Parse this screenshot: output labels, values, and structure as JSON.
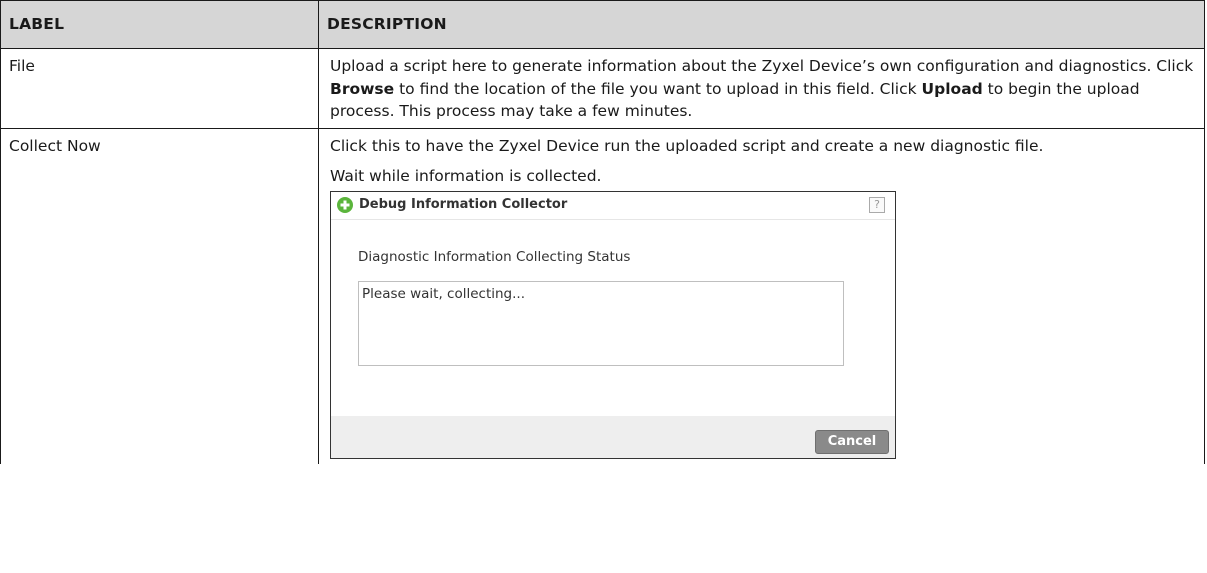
{
  "table": {
    "headers": {
      "label": "LABEL",
      "description": "DESCRIPTION"
    },
    "rows": [
      {
        "label": "File",
        "desc_parts": [
          "Upload a script here to generate information about the Zyxel Device’s own configuration and diagnostics. Click ",
          "Browse",
          " to find the location of the file you want to upload in this field. Click ",
          "Upload",
          " to begin the upload process. This process may take a few minutes."
        ]
      },
      {
        "label": "Collect Now",
        "desc_para1": "Click this to have the Zyxel Device run the uploaded script and create a new diagnostic file.",
        "desc_para2": "Wait while information is collected."
      }
    ]
  },
  "dialog": {
    "title": "Debug Information Collector",
    "help_icon": "?",
    "status_label": "Diagnostic Information Collecting Status",
    "status_text": "Please wait, collecting...",
    "cancel_label": "Cancel",
    "icons": {
      "title_icon": "add-circle-icon",
      "help": "help-icon"
    },
    "colors": {
      "title_icon": "#5bb53c",
      "cancel_bg": "#8a8a8a",
      "footer_bg": "#eeeeee"
    }
  }
}
